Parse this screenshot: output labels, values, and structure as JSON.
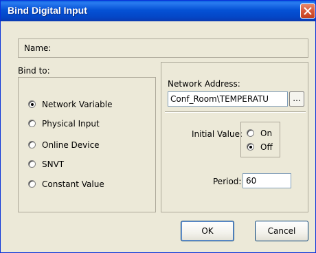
{
  "window": {
    "title": "Bind Digital Input",
    "close_icon": "close-icon"
  },
  "name_label": "Name:",
  "bind_to": {
    "label": "Bind to:",
    "options": [
      {
        "label": "Network Variable",
        "checked": true
      },
      {
        "label": "Physical Input",
        "checked": false
      },
      {
        "label": "Online Device",
        "checked": false
      },
      {
        "label": "SNVT",
        "checked": false
      },
      {
        "label": "Constant Value",
        "checked": false
      }
    ]
  },
  "network": {
    "label": "Network Address:",
    "value": "Conf_Room\\TEMPERATU",
    "browse_label": "..."
  },
  "initial_value": {
    "label": "Initial Value:",
    "on_label": "On",
    "off_label": "Off",
    "selected": "Off"
  },
  "period": {
    "label": "Period:",
    "value": "60"
  },
  "buttons": {
    "ok": "OK",
    "cancel": "Cancel"
  },
  "colors": {
    "titlebar": "#0552d6",
    "dialog_bg": "#ece9d8",
    "close_button": "#d7583a"
  }
}
